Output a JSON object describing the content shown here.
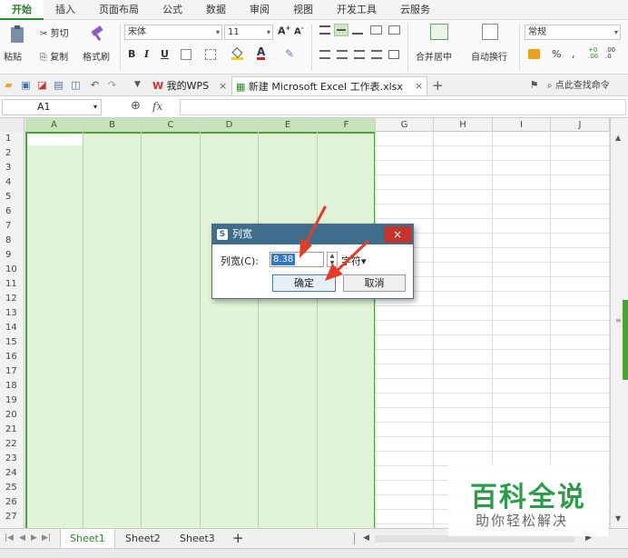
{
  "ribbon_tabs": [
    "开始",
    "插入",
    "页面布局",
    "公式",
    "数据",
    "审阅",
    "视图",
    "开发工具",
    "云服务"
  ],
  "toolbar": {
    "paste": "粘贴",
    "cut": "剪切",
    "copy": "复制",
    "format_painter": "格式刷",
    "font_name": "宋体",
    "font_size": "11",
    "bold": "B",
    "italic": "I",
    "underline": "U",
    "merge_center": "合并居中",
    "wrap_text": "自动换行",
    "number_format": "常规",
    "percent": "%"
  },
  "doc_tabs": {
    "wps_home": "我的WPS",
    "workbook": "新建 Microsoft Excel 工作表.xlsx",
    "close": "×",
    "add": "+",
    "search": "点此查找命令"
  },
  "formula_bar": {
    "name_box": "A1",
    "fx": "fx"
  },
  "columns": [
    "A",
    "B",
    "C",
    "D",
    "E",
    "F",
    "G",
    "H",
    "I",
    "J"
  ],
  "rows": [
    "1",
    "2",
    "3",
    "4",
    "5",
    "6",
    "7",
    "8",
    "9",
    "10",
    "11",
    "12",
    "13",
    "14",
    "15",
    "16",
    "17",
    "18",
    "19",
    "20",
    "21",
    "22",
    "23",
    "24",
    "25",
    "26",
    "27"
  ],
  "sheets": [
    "Sheet1",
    "Sheet2",
    "Sheet3"
  ],
  "sheet_add": "+",
  "dialog": {
    "title": "列宽",
    "close": "×",
    "label": "列宽(C):",
    "value": "8.38",
    "unit": "字符▾",
    "ok": "确定",
    "cancel": "取消"
  },
  "watermark": {
    "line1": "百科全说",
    "line2": "助你轻松解决"
  },
  "colors": {
    "selection_fill": "#e2f4d7",
    "selection_border": "#4aa13a",
    "dialog_title": "#3f6e8c",
    "close_red": "#c4342c",
    "arrow_red": "#e23c2c",
    "watermark_green": "#2f9b4a"
  }
}
